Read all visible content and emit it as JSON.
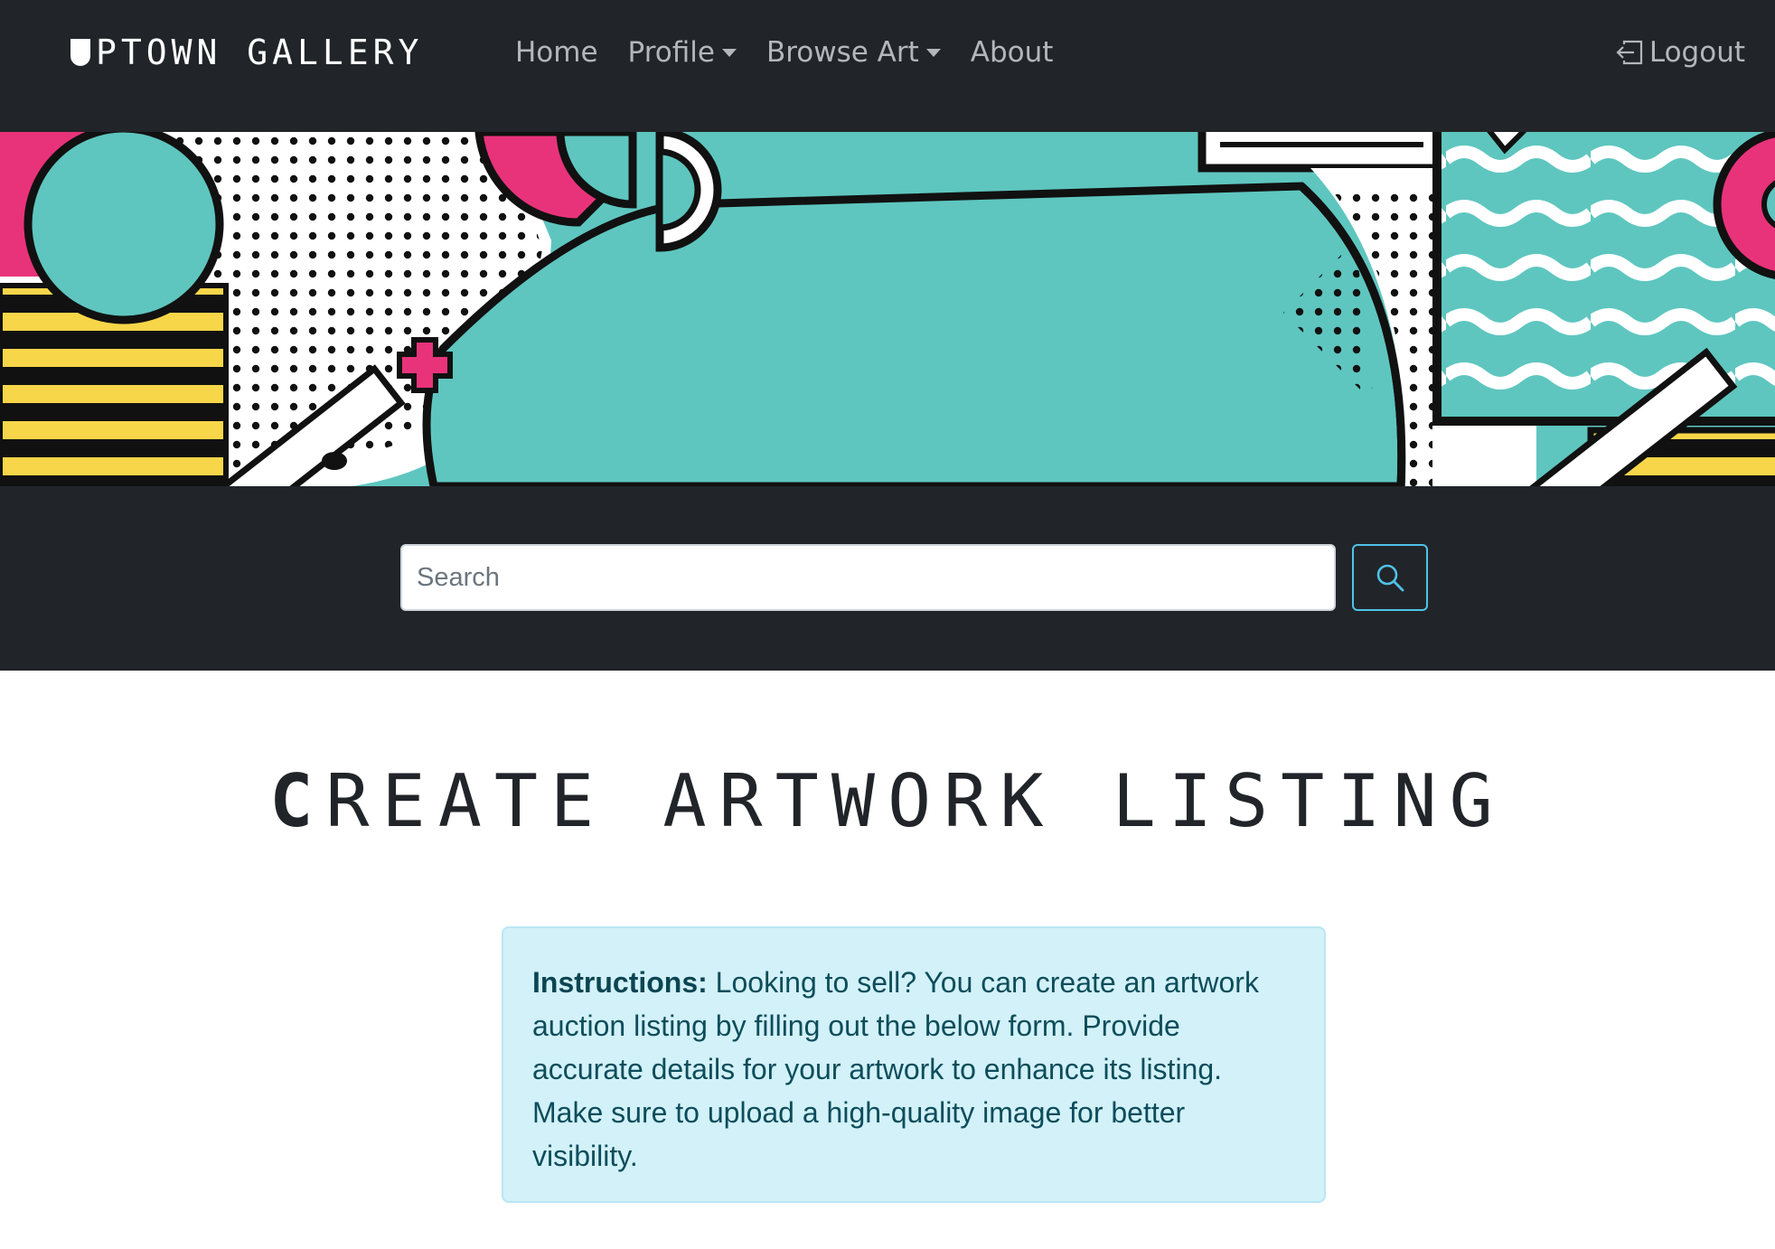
{
  "brand": {
    "first_letter": "U",
    "rest": "PTOWN GALLERY"
  },
  "nav": {
    "items": [
      {
        "label": "Home",
        "dropdown": false
      },
      {
        "label": "Profile",
        "dropdown": true
      },
      {
        "label": "Browse Art",
        "dropdown": true
      },
      {
        "label": "About",
        "dropdown": false
      }
    ],
    "logout_label": "Logout"
  },
  "search": {
    "placeholder": "Search"
  },
  "title": {
    "first": "C",
    "rest": "REATE ARTWORK LISTING"
  },
  "instructions": {
    "label": "Instructions:",
    "text": " Looking to sell? You can create an artwork auction listing by filling out the below form. Provide accurate details for your artwork to enhance its listing. Make sure to upload a high-quality image for better visibility."
  },
  "colors": {
    "navbar": "#212529",
    "teal": "#5ec6bf",
    "pink": "#e8337a",
    "yellow": "#f8d649",
    "accent_info": "#4fc3e8",
    "alert_bg": "#d2f1f9"
  },
  "icons": {
    "logout": "box-arrow-in-left-icon",
    "search": "search-icon"
  }
}
